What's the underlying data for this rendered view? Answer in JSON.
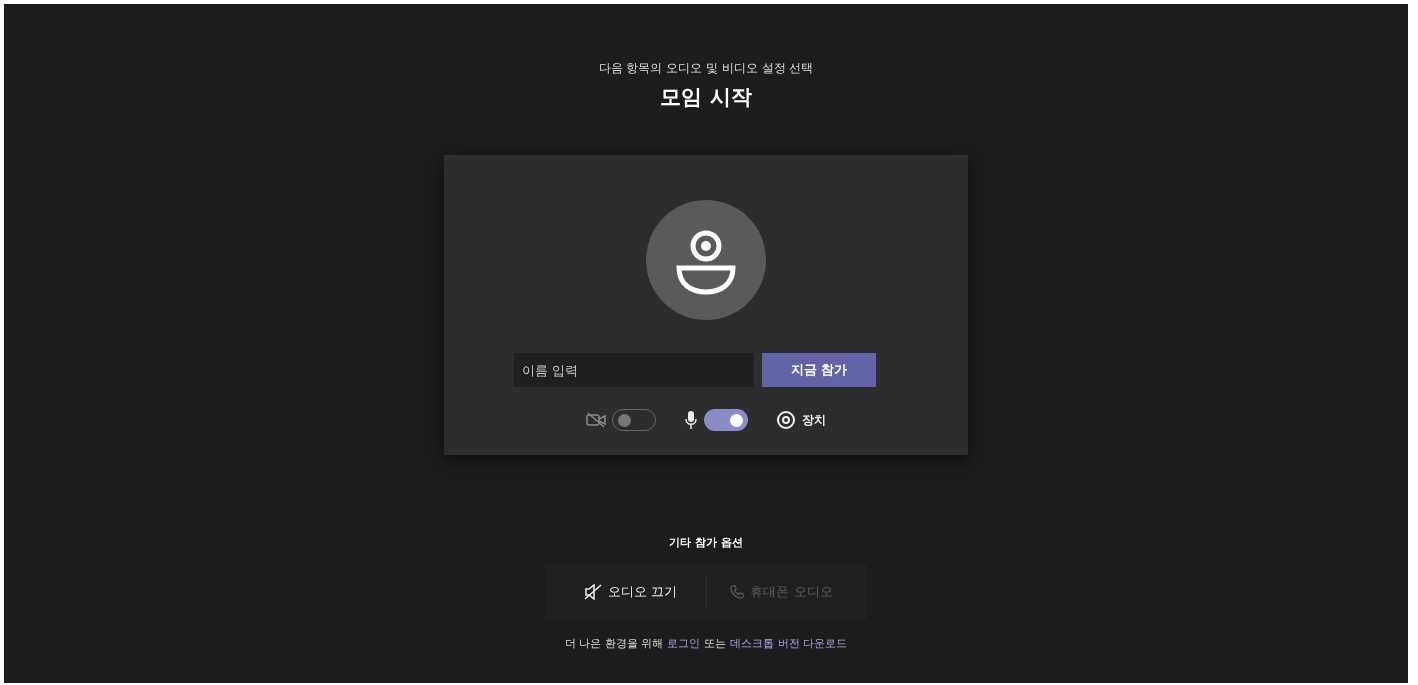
{
  "header": {
    "subtitle": "다음 항목의 오디오 및 비디오 설정 선택",
    "title": "모임 시작"
  },
  "preview": {
    "name_field": {
      "placeholder": "이름 입력"
    },
    "join_button": "지금 참가",
    "toggles": [
      {
        "kind": "camera",
        "on": false
      },
      {
        "kind": "mic",
        "on": true
      }
    ],
    "device_button": "장치"
  },
  "other_options": {
    "label": "기타 참가 옵션",
    "options": [
      {
        "kind": "mute",
        "label": "오디오 끄기",
        "disabled": false
      },
      {
        "kind": "phone",
        "label": "휴대폰 오디오",
        "disabled": true
      }
    ]
  },
  "footer": [
    {
      "kind": "text",
      "text": "더 나은 환경을 위해"
    },
    {
      "kind": "link",
      "text": "로그인"
    },
    {
      "kind": "text",
      "text": "또는"
    },
    {
      "kind": "link",
      "text": "데스크톱 버전 다운로드"
    }
  ]
}
